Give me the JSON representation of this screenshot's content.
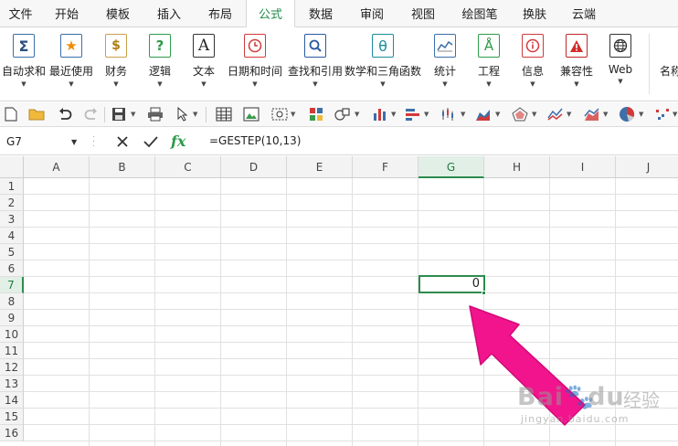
{
  "menu": {
    "tabs": [
      "文件",
      "开始",
      "模板",
      "插入",
      "布局",
      "公式",
      "数据",
      "审阅",
      "视图",
      "绘图笔",
      "换肤",
      "云端"
    ],
    "active": "公式"
  },
  "ribbon": {
    "buttons": [
      {
        "label": "自动求和",
        "icon": "sigma-icon",
        "glyph": "Σ"
      },
      {
        "label": "最近使用",
        "icon": "star-icon",
        "glyph": "★"
      },
      {
        "label": "财务",
        "icon": "money-bag-icon",
        "glyph": "$"
      },
      {
        "label": "逻辑",
        "icon": "question-icon",
        "glyph": "?"
      },
      {
        "label": "文本",
        "icon": "text-icon",
        "glyph": "A"
      },
      {
        "label": "日期和时间",
        "icon": "clock-icon",
        "glyph": "◷"
      },
      {
        "label": "查找和引用",
        "icon": "magnifier-icon",
        "glyph": "⌕"
      },
      {
        "label": "数学和三角函数",
        "icon": "theta-icon",
        "glyph": "θ"
      },
      {
        "label": "统计",
        "icon": "statistics-icon",
        "glyph": "∿"
      },
      {
        "label": "工程",
        "icon": "compass-icon",
        "glyph": "Å"
      },
      {
        "label": "信息",
        "icon": "info-icon",
        "glyph": "i"
      },
      {
        "label": "兼容性",
        "icon": "warning-icon",
        "glyph": "!"
      },
      {
        "label": "Web",
        "icon": "globe-icon",
        "glyph": "⊕"
      },
      {
        "label": "名称",
        "icon": "name-manager-icon",
        "glyph": ""
      }
    ]
  },
  "formula_bar": {
    "name_box": "G7",
    "fx_label": "fx",
    "formula": "=GESTEP(10,13)"
  },
  "sheet": {
    "columns": [
      "A",
      "B",
      "C",
      "D",
      "E",
      "F",
      "G",
      "H",
      "I",
      "J"
    ],
    "rows": [
      "1",
      "2",
      "3",
      "4",
      "5",
      "6",
      "7",
      "8",
      "9",
      "10",
      "11",
      "12",
      "13",
      "14",
      "15",
      "16"
    ],
    "selected_column": "G",
    "selected_row": "7",
    "g7_value": "0"
  },
  "watermark": {
    "brand": "Bai",
    "brand2": "du",
    "suffix": "经验",
    "url": "jingyan.baidu.com"
  },
  "colors": {
    "accent_green": "#2e8b4f",
    "arrow_pink": "#f2148c"
  }
}
